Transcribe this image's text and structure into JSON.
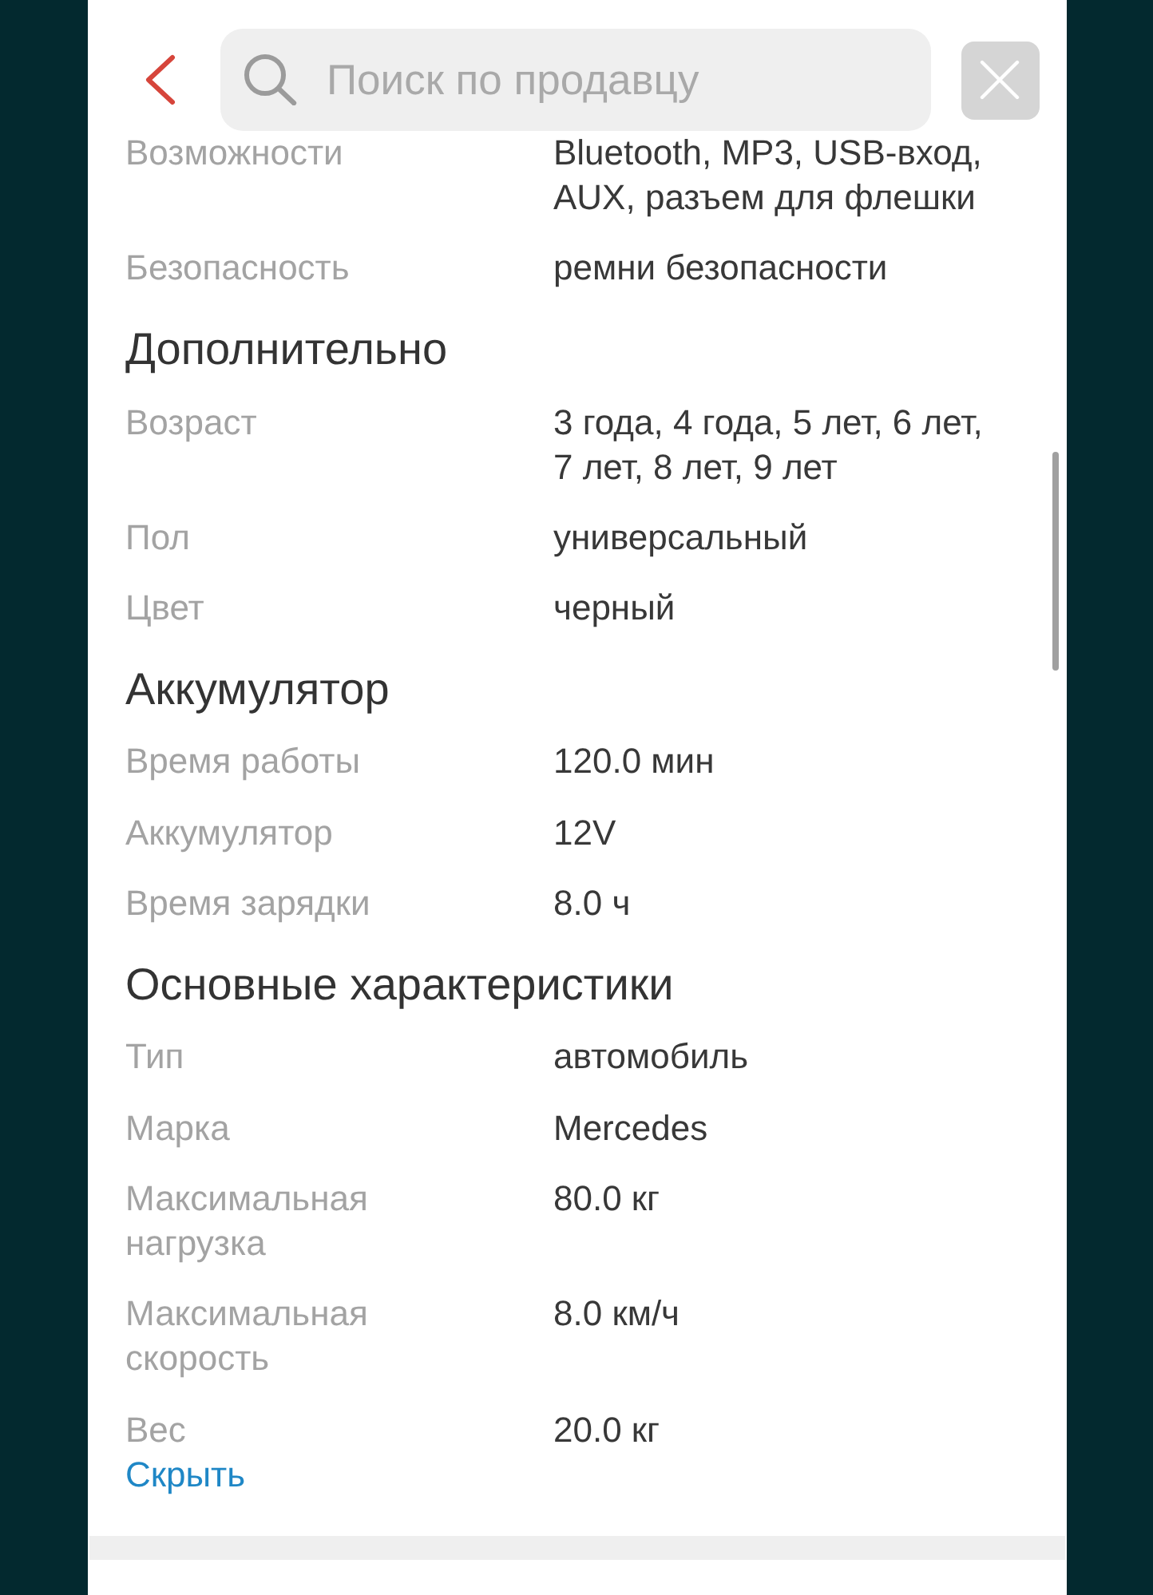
{
  "top_bar": {
    "search": {
      "placeholder": "Поиск по продавцу"
    }
  },
  "sections": [
    {
      "rows": [
        {
          "label": "Возможности",
          "value": "Bluetooth, MP3, USB-вход, AUX, разъем для флешки"
        },
        {
          "label": "Безопасность",
          "value": "ремни безопасности"
        }
      ]
    },
    {
      "title": "Дополнительно",
      "rows": [
        {
          "label": "Возраст",
          "value": "3 года, 4 года, 5 лет, 6 лет, 7 лет, 8 лет, 9 лет"
        },
        {
          "label": "Пол",
          "value": "универсальный"
        },
        {
          "label": "Цвет",
          "value": "черный"
        }
      ]
    },
    {
      "title": "Аккумулятор",
      "rows": [
        {
          "label": "Время работы",
          "value": "120.0 мин"
        },
        {
          "label": "Аккумулятор",
          "value": "12V"
        },
        {
          "label": "Время зарядки",
          "value": "8.0 ч"
        }
      ]
    },
    {
      "title": "Основные характеристики",
      "rows": [
        {
          "label": "Тип",
          "value": "автомобиль"
        },
        {
          "label": "Марка",
          "value": "Mercedes"
        },
        {
          "label": "Максимальная нагрузка",
          "value": "80.0 кг"
        },
        {
          "label": "Максимальная скорость",
          "value": "8.0 км/ч"
        },
        {
          "label": "Вес",
          "value": "20.0 кг"
        }
      ]
    }
  ],
  "hide_link": "Скрыть"
}
